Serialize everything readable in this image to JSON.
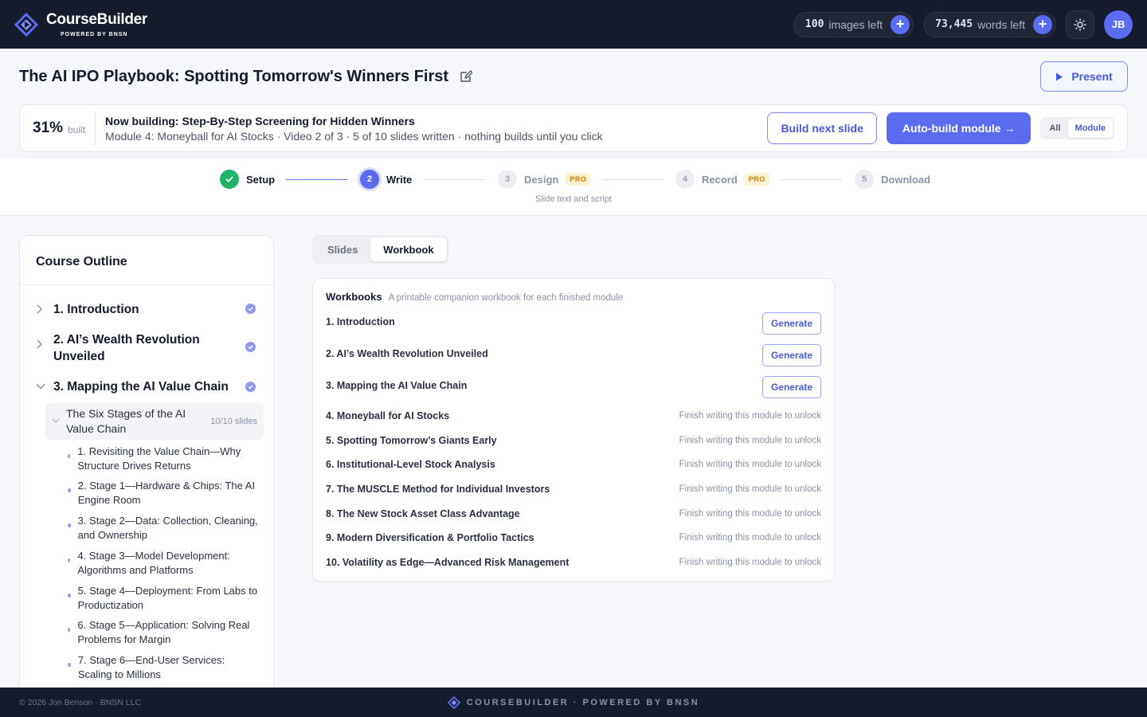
{
  "header": {
    "brand_name": "CourseBuilder",
    "brand_sub": "POWERED BY BNSN",
    "images_count": "100",
    "images_label": "images left",
    "words_count": "73,445",
    "words_label": "words left",
    "avatar_initials": "JB"
  },
  "page": {
    "title": "The AI IPO Playbook: Spotting Tomorrow's Winners First",
    "present_label": "Present"
  },
  "build": {
    "percent": "31%",
    "percent_label": "built",
    "title": "Now building: Step-By-Step Screening for Hidden Winners",
    "subtitle": "Module 4: Moneyball for AI Stocks · Video 2 of 3 · 5 of 10 slides written · nothing builds until you click",
    "build_next_label": "Build next slide",
    "auto_build_label": "Auto-build module →",
    "scope_options": [
      "All",
      "Module"
    ],
    "scope_selected": "Module"
  },
  "stepper": {
    "steps": [
      {
        "number": "1",
        "label": "Setup",
        "state": "done"
      },
      {
        "number": "2",
        "label": "Write",
        "state": "current"
      },
      {
        "number": "3",
        "label": "Design",
        "state": "todo",
        "badge": "PRO"
      },
      {
        "number": "4",
        "label": "Record",
        "state": "todo",
        "badge": "PRO"
      },
      {
        "number": "5",
        "label": "Download",
        "state": "todo"
      }
    ],
    "caption": "Slide text and script"
  },
  "outline": {
    "heading": "Course Outline",
    "modules": [
      {
        "title": "1. Introduction",
        "expanded": false,
        "complete": true
      },
      {
        "title": "2. AI’s Wealth Revolution Unveiled",
        "expanded": false,
        "complete": true
      },
      {
        "title": "3. Mapping the AI Value Chain",
        "expanded": true,
        "complete": true
      }
    ],
    "video": {
      "title": "The Six Stages of the AI Value Chain",
      "count": "10/10 slides"
    },
    "slides": [
      "1. Revisiting the Value Chain—Why Structure Drives Returns",
      "2. Stage 1—Hardware & Chips: The AI Engine Room",
      "3. Stage 2—Data: Collection, Cleaning, and Ownership",
      "4. Stage 3—Model Development: Algorithms and Platforms",
      "5. Stage 4—Deployment: From Labs to Productization",
      "6. Stage 5—Application: Solving Real Problems for Margin",
      "7. Stage 6—End-User Services: Scaling to Millions"
    ]
  },
  "tabs": {
    "items": [
      "Slides",
      "Workbook"
    ],
    "active": "Workbook"
  },
  "workbooks": {
    "title": "Workbooks",
    "subtitle": "A printable companion workbook for each finished module",
    "generate_label": "Generate",
    "locked_label": "Finish writing this module to unlock",
    "items": [
      {
        "name": "1. Introduction",
        "status": "ready"
      },
      {
        "name": "2. AI’s Wealth Revolution Unveiled",
        "status": "ready"
      },
      {
        "name": "3. Mapping the AI Value Chain",
        "status": "ready"
      },
      {
        "name": "4. Moneyball for AI Stocks",
        "status": "locked"
      },
      {
        "name": "5. Spotting Tomorrow’s Giants Early",
        "status": "locked"
      },
      {
        "name": "6. Institutional-Level Stock Analysis",
        "status": "locked"
      },
      {
        "name": "7. The MUSCLE Method for Individual Investors",
        "status": "locked"
      },
      {
        "name": "8. The New Stock Asset Class Advantage",
        "status": "locked"
      },
      {
        "name": "9. Modern Diversification & Portfolio Tactics",
        "status": "locked"
      },
      {
        "name": "10. Volatility as Edge—Advanced Risk Management",
        "status": "locked"
      }
    ]
  },
  "footer": {
    "copyright": "© 2026 Jon Benson · BNSN LLC",
    "brand": "COURSEBUILDER · POWERED BY BNSN"
  },
  "colors": {
    "accent": "#5b6cf0",
    "topbar": "#141b2d",
    "success": "#22b36b",
    "pro_badge": "#c77b00"
  }
}
